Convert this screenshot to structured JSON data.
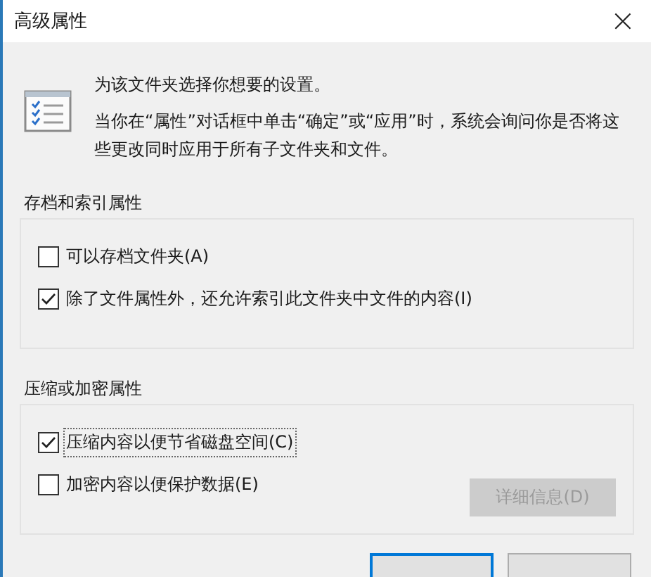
{
  "window": {
    "title": "高级属性",
    "close": "×"
  },
  "intro": {
    "heading": "为该文件夹选择你想要的设置。",
    "text": "当你在“属性”对话框中单击“确定”或“应用”时，系统会询问你是否将这些更改同时应用于所有子文件夹和文件。"
  },
  "groups": [
    {
      "title": "存档和索引属性",
      "options": [
        {
          "label": "可以存档文件夹(A)",
          "checked": false,
          "focused": false
        },
        {
          "label": "除了文件属性外，还允许索引此文件夹中文件的内容(I)",
          "checked": true,
          "focused": false
        }
      ]
    },
    {
      "title": "压缩或加密属性",
      "options": [
        {
          "label": "压缩内容以便节省磁盘空间(C)",
          "checked": true,
          "focused": true
        },
        {
          "label": "加密内容以便保护数据(E)",
          "checked": false,
          "focused": false
        }
      ],
      "button": {
        "label": "详细信息(D)",
        "disabled": true
      }
    }
  ]
}
